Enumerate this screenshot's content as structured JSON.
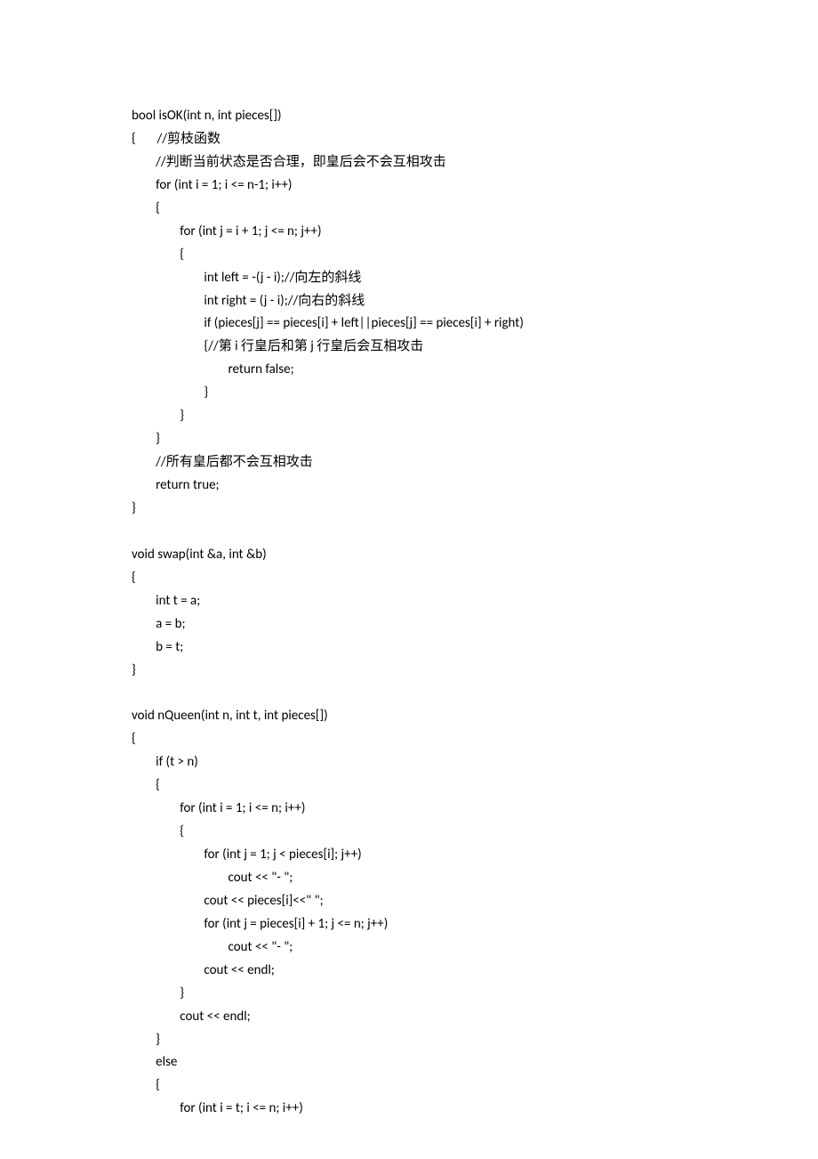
{
  "lines": [
    "bool isOK(int n, int pieces[])",
    "{       //剪枝函数",
    "        //判断当前状态是否合理，即皇后会不会互相攻击",
    "        for (int i = 1; i <= n-1; i++)",
    "        {",
    "                for (int j = i + 1; j <= n; j++)",
    "                {",
    "                        int left = -(j - i);//向左的斜线",
    "                        int right = (j - i);//向右的斜线",
    "                        if (pieces[j] == pieces[i] + left||pieces[j] == pieces[i] + right)",
    "                        {//第 i 行皇后和第 j 行皇后会互相攻击",
    "                                return false;",
    "                        }",
    "                }",
    "        }",
    "        //所有皇后都不会互相攻击",
    "        return true;",
    "}",
    "",
    "void swap(int &a, int &b)",
    "{",
    "        int t = a;",
    "        a = b;",
    "        b = t;",
    "}",
    "",
    "void nQueen(int n, int t, int pieces[])",
    "{",
    "        if (t > n)",
    "        {",
    "                for (int i = 1; i <= n; i++)",
    "                {",
    "                        for (int j = 1; j < pieces[i]; j++)",
    "                                cout << \"- \";",
    "                        cout << pieces[i]<<\" \";",
    "                        for (int j = pieces[i] + 1; j <= n; j++)",
    "                                cout << \"- \";",
    "                        cout << endl;",
    "                }",
    "                cout << endl;",
    "        }",
    "        else",
    "        {",
    "                for (int i = t; i <= n; i++)"
  ]
}
